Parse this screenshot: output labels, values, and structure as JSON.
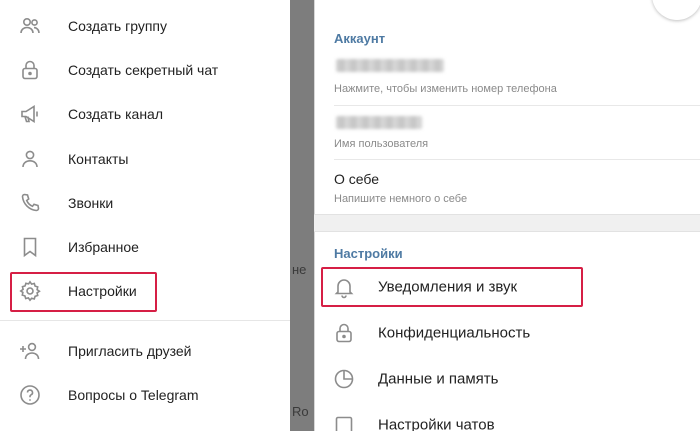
{
  "drawer": {
    "items": [
      {
        "label": "Создать группу",
        "icon": "group-icon"
      },
      {
        "label": "Создать секретный чат",
        "icon": "lock-icon"
      },
      {
        "label": "Создать канал",
        "icon": "megaphone-icon"
      },
      {
        "label": "Контакты",
        "icon": "person-icon"
      },
      {
        "label": "Звонки",
        "icon": "phone-icon"
      },
      {
        "label": "Избранное",
        "icon": "bookmark-icon"
      },
      {
        "label": "Настройки",
        "icon": "gear-icon"
      },
      {
        "label": "Пригласить друзей",
        "icon": "add-person-icon"
      },
      {
        "label": "Вопросы о Telegram",
        "icon": "question-icon"
      }
    ],
    "backdrop_fragments": [
      "не",
      "Ro"
    ]
  },
  "settings": {
    "account": {
      "section_title": "Аккаунт",
      "phone_hint": "Нажмите, чтобы изменить номер телефона",
      "username_hint": "Имя пользователя",
      "bio_label": "О себе",
      "bio_hint": "Напишите немного о себе"
    },
    "section_title": "Настройки",
    "items": [
      {
        "label": "Уведомления и звук",
        "icon": "bell-icon"
      },
      {
        "label": "Конфиденциальность",
        "icon": "lock-icon"
      },
      {
        "label": "Данные и память",
        "icon": "pie-chart-icon"
      },
      {
        "label": "Настройки чатов",
        "icon": "chat-settings-icon"
      }
    ]
  },
  "colors": {
    "highlight": "#d61f45",
    "section_title": "#4e7aa3",
    "icon": "#8c8c8c"
  }
}
